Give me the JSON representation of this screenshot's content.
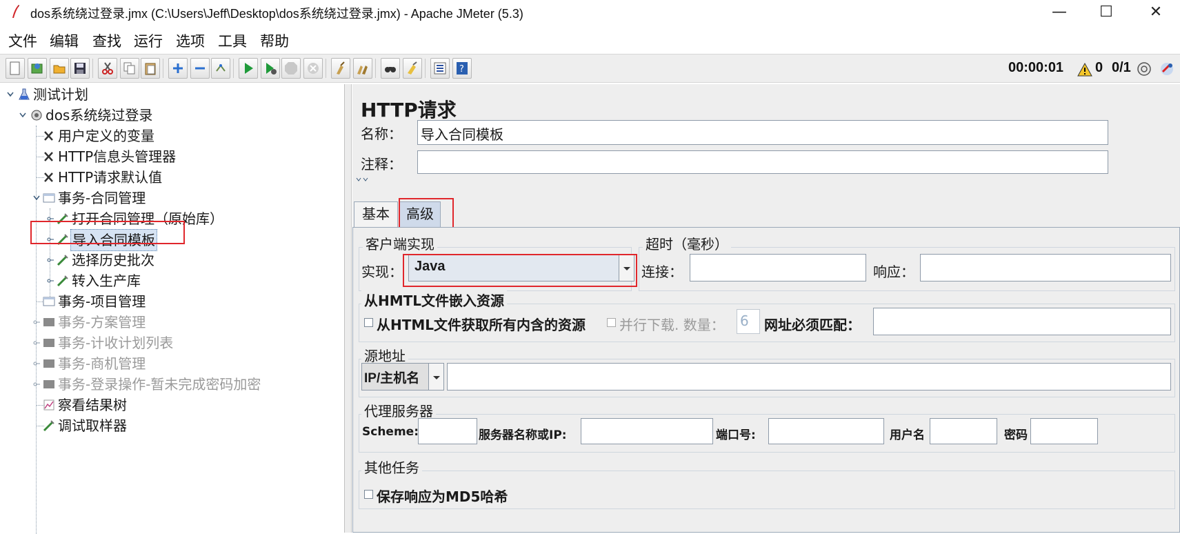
{
  "window": {
    "title": "dos系统绕过登录.jmx (C:\\Users\\Jeff\\Desktop\\dos系统绕过登录.jmx) - Apache JMeter (5.3)",
    "minimize": "—",
    "maximize": "☐",
    "close": "✕"
  },
  "menu": [
    "文件",
    "编辑",
    "查找",
    "运行",
    "选项",
    "工具",
    "帮助"
  ],
  "status": {
    "timer": "00:00:01",
    "warnings": "0",
    "threads": "0/1"
  },
  "tree": {
    "items": [
      {
        "label": "测试计划",
        "icon": "test-plan-icon"
      },
      {
        "label": "dos系统绕过登录",
        "icon": "thread-group-icon"
      },
      {
        "label": "用户定义的变量",
        "icon": "config-element-icon"
      },
      {
        "label": "HTTP信息头管理器",
        "icon": "config-element-icon"
      },
      {
        "label": "HTTP请求默认值",
        "icon": "config-element-icon"
      },
      {
        "label": "事务-合同管理",
        "icon": "transaction-controller-icon"
      },
      {
        "label": "打开合同管理（原始库）",
        "icon": "sampler-icon"
      },
      {
        "label": "导入合同模板",
        "icon": "sampler-icon"
      },
      {
        "label": "选择历史批次",
        "icon": "sampler-icon"
      },
      {
        "label": "转入生产库",
        "icon": "sampler-icon"
      },
      {
        "label": "事务-项目管理",
        "icon": "transaction-controller-icon"
      },
      {
        "label": "事务-方案管理",
        "icon": "transaction-controller-icon"
      },
      {
        "label": "事务-计收计划列表",
        "icon": "transaction-controller-icon"
      },
      {
        "label": "事务-商机管理",
        "icon": "transaction-controller-icon"
      },
      {
        "label": "事务-登录操作-暂未完成密码加密",
        "icon": "transaction-controller-icon"
      },
      {
        "label": "察看结果树",
        "icon": "listener-icon"
      },
      {
        "label": "调试取样器",
        "icon": "sampler-icon"
      }
    ]
  },
  "panel": {
    "title": "HTTP请求",
    "name_label": "名称：",
    "name_value": "导入合同模板",
    "comment_label": "注释：",
    "comment_value": "",
    "tabs": [
      "基本",
      "高级"
    ],
    "client": {
      "title": "客户端实现",
      "impl_label": "实现：",
      "impl_value": "Java"
    },
    "timeout": {
      "title": "超时（毫秒）",
      "connect_label": "连接：",
      "connect_value": "",
      "response_label": "响应：",
      "response_value": ""
    },
    "embedded": {
      "title": "从HMTL文件嵌入资源",
      "retrieve_label": "从HTML文件获取所有内含的资源",
      "parallel_label": "并行下载. 数量：",
      "parallel_value": "6",
      "url_match_label": "网址必须匹配：",
      "url_match_value": ""
    },
    "source": {
      "title": "源地址",
      "type_value": "IP/主机名",
      "address_value": ""
    },
    "proxy": {
      "title": "代理服务器",
      "scheme_label": "Scheme:",
      "scheme_value": "",
      "server_label": "服务器名称或IP:",
      "server_value": "",
      "port_label": "端口号:",
      "port_value": "",
      "user_label": "用户名",
      "user_value": "",
      "password_label": "密码",
      "password_value": ""
    },
    "other": {
      "title": "其他任务",
      "md5_label": "保存响应为MD5哈希"
    }
  },
  "colors": {
    "highlight_box": "#e0262b",
    "tab_active": "#cfdaea",
    "panel_bg": "#eeeeee"
  }
}
